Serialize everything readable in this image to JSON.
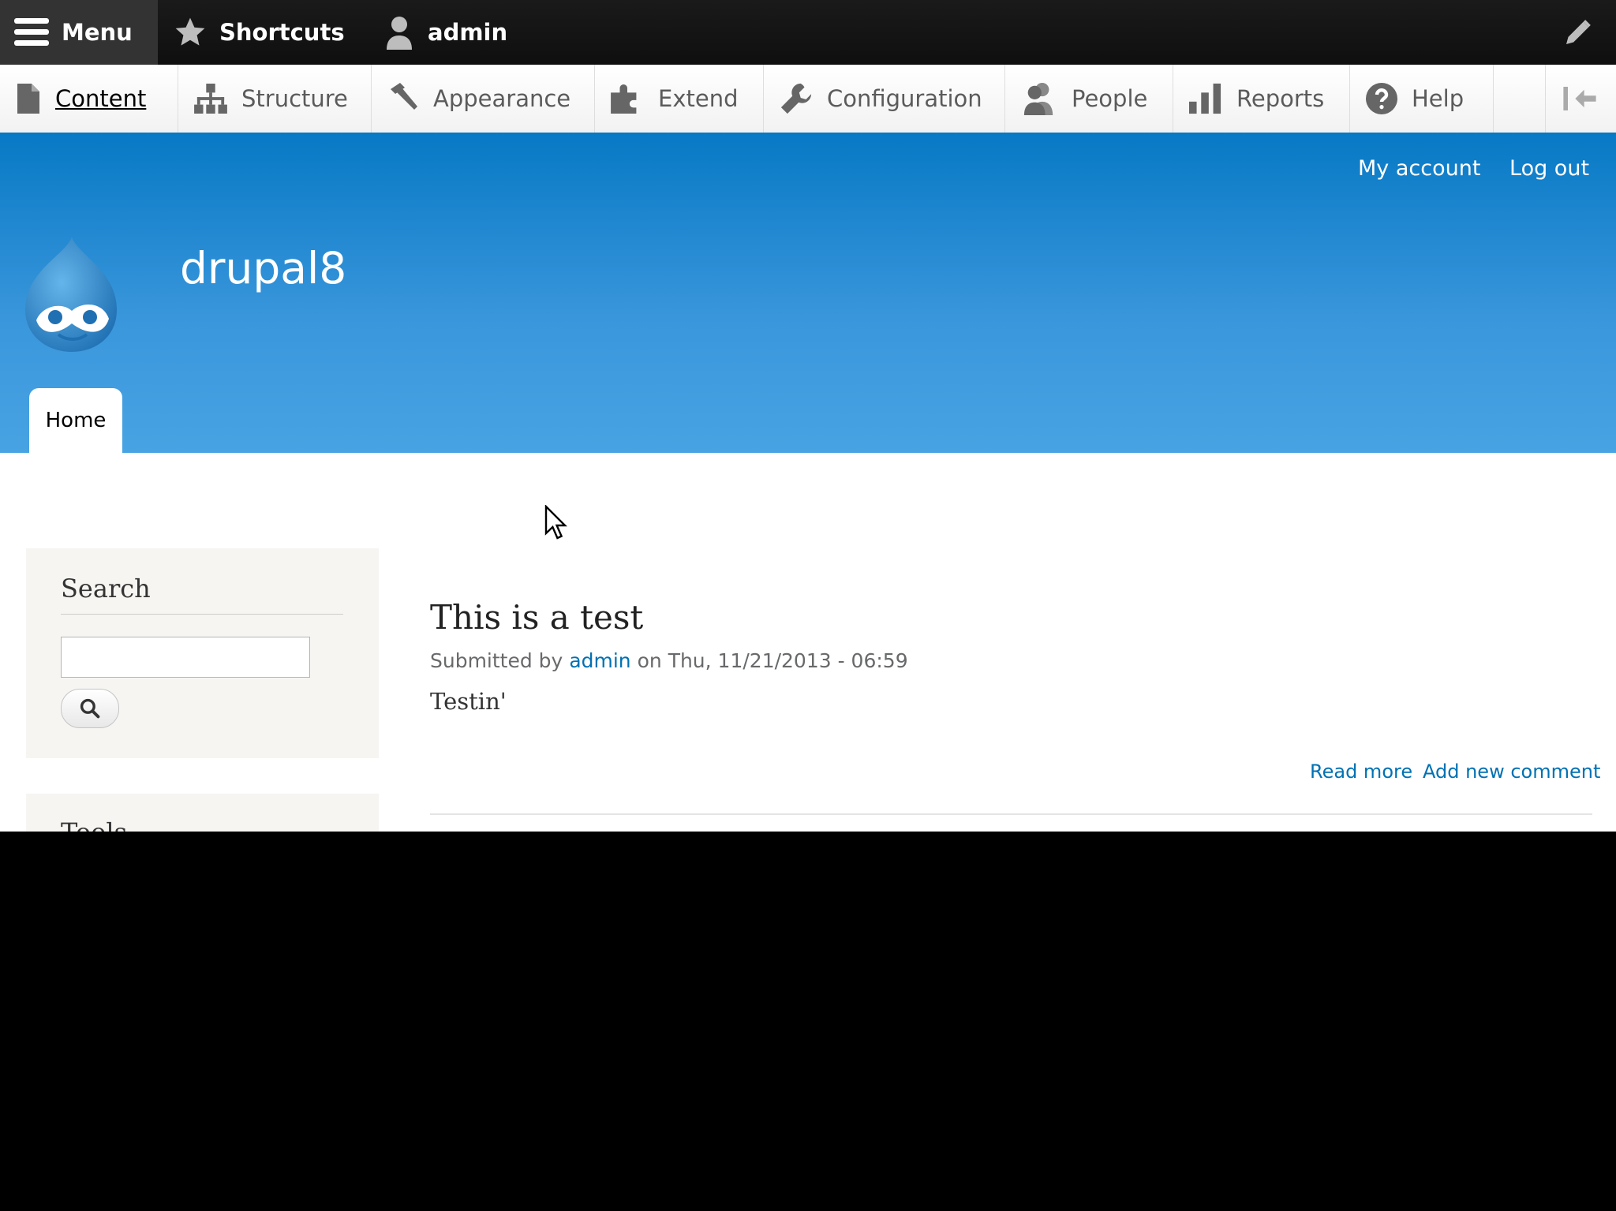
{
  "toolbar": {
    "menu_label": "Menu",
    "shortcuts_label": "Shortcuts",
    "user_label": "admin",
    "edit_icon": "pencil-icon"
  },
  "tray": {
    "items": [
      {
        "label": "Content",
        "icon": "document-icon",
        "active": true
      },
      {
        "label": "Structure",
        "icon": "sitemap-icon"
      },
      {
        "label": "Appearance",
        "icon": "paintbrush-icon"
      },
      {
        "label": "Extend",
        "icon": "puzzle-icon"
      },
      {
        "label": "Configuration",
        "icon": "wrench-icon"
      },
      {
        "label": "People",
        "icon": "people-icon"
      },
      {
        "label": "Reports",
        "icon": "bar-chart-icon"
      },
      {
        "label": "Help",
        "icon": "help-icon"
      }
    ],
    "collapse_icon": "collapse-tray-icon"
  },
  "header": {
    "secondary_links": [
      "My account",
      "Log out"
    ],
    "site_name": "drupal8",
    "primary_tab": "Home"
  },
  "sidebar": {
    "search_title": "Search",
    "search_value": "",
    "tools_title": "Tools"
  },
  "node": {
    "title": "This is a test",
    "submitted_prefix": "Submitted by",
    "author": "admin",
    "submitted_suffix": "on Thu, 11/21/2013 - 06:59",
    "body": "Testin'",
    "links": [
      "Read more",
      "Add new comment"
    ]
  },
  "colors": {
    "toolbar_bg": "#0f0f0f",
    "header_top": "#0779c5",
    "header_bottom": "#47a3e2",
    "link": "#0071b3"
  }
}
